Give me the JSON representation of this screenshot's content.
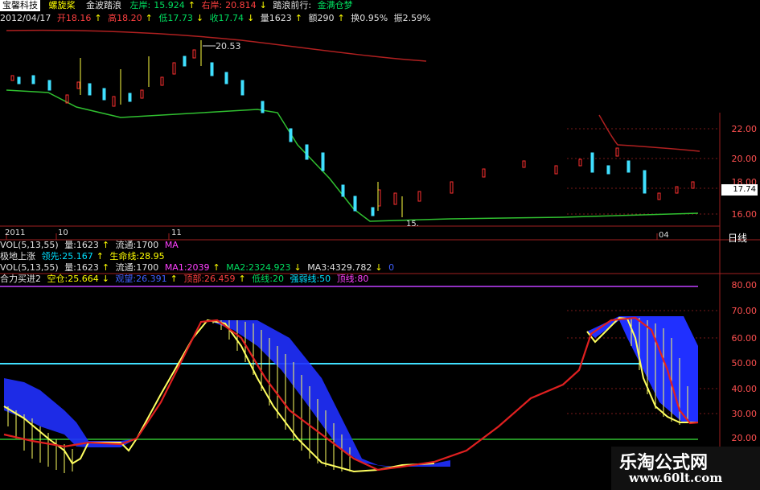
{
  "tabs": [
    "宝馨科技",
    "螺旋桨",
    "金波踏浪"
  ],
  "header_top": {
    "left_label": "左岸:",
    "left_val": "15.924",
    "right_label": "右岸:",
    "right_val": "20.814",
    "extra1": "踏浪前行:",
    "extra2": "金满仓梦"
  },
  "quote": {
    "date": "2012/04/17",
    "open": "开18.16",
    "high": "高18.20",
    "low": "低17.73",
    "close": "收17.74",
    "vol": "量1623",
    "amount": "额290",
    "turnover": "换0.95%",
    "amplitude": "振2.59%"
  },
  "price_panel": {
    "peak_label": "20.53",
    "low_label": "15.",
    "x_labels": [
      "2011",
      "10",
      "11",
      "04"
    ],
    "y_labels": [
      "22.00",
      "20.00",
      "18.00",
      "16.00"
    ],
    "current_price": "17.74",
    "period_label": "日线"
  },
  "indicator_rows": [
    {
      "name": "VOL(5,13,55)",
      "a": "量:1623",
      "b": "流通:1700",
      "c": "MA"
    },
    {
      "name": "极地上涨",
      "a": "领先:25.167",
      "b": "生命线:28.95"
    },
    {
      "name": "VOL(5,13,55)",
      "a": "量:1623",
      "b": "流通:1700",
      "c": "MA1:2039",
      "d": "MA2:2324.923",
      "e": "MA3:4329.782",
      "f": "0"
    },
    {
      "name": "合力买进2",
      "a": "空仓:25.664",
      "b": "观望:26.391",
      "c": "顶部:26.459",
      "d": "低线:20",
      "e": "强弱线:50",
      "f": "顶线:80"
    }
  ],
  "oscillator": {
    "y_labels": [
      "80.00",
      "70.00",
      "60.00",
      "50.00",
      "40.00",
      "30.00",
      "20.00"
    ]
  },
  "watermark": {
    "title": "乐淘公式网",
    "url": "www.60lt.com"
  },
  "colors": {
    "red": "#cc2020",
    "green": "#20c020",
    "cyan": "#40e0ff",
    "yellow": "#ffff60",
    "blue": "#2030ff",
    "magenta": "#c040ff"
  }
}
